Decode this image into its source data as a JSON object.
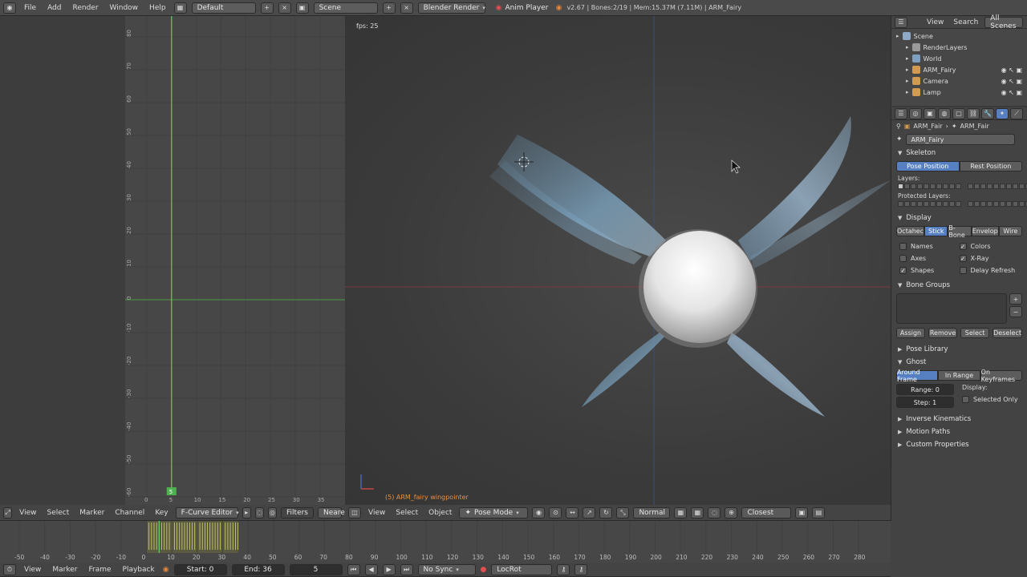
{
  "topbar": {
    "menus": [
      "File",
      "Add",
      "Render",
      "Window",
      "Help"
    ],
    "screen_layout": "Default",
    "scene": "Scene",
    "render_engine": "Blender Render",
    "anim_player": "Anim Player",
    "stats": "v2.67 | Bones:2/19 | Mem:15.37M (7.11M) | ARM_Fairy"
  },
  "graph_editor": {
    "y_ticks": [
      "80",
      "70",
      "60",
      "50",
      "40",
      "30",
      "20",
      "10",
      "0",
      "-10",
      "-20",
      "-30",
      "-40",
      "-50",
      "-60"
    ],
    "x_ticks": [
      "0",
      "5",
      "10",
      "15",
      "20",
      "25",
      "30",
      "35"
    ],
    "current_frame": "5",
    "header": {
      "menus": [
        "View",
        "Select",
        "Marker",
        "Channel",
        "Key"
      ],
      "mode": "F-Curve Editor",
      "filters": "Filters",
      "near": "Neare"
    }
  },
  "viewport": {
    "fps": "fps: 25",
    "object_label": "(5) ARM_fairy wingpointer",
    "header": {
      "menus": [
        "View",
        "Select",
        "Object"
      ],
      "mode": "Pose Mode",
      "orientation": "Normal",
      "snap": "Closest"
    }
  },
  "outliner": {
    "header": [
      "View",
      "Search",
      "All Scenes"
    ],
    "items": [
      {
        "label": "Scene",
        "indent": 0,
        "color": "#8fa9c9"
      },
      {
        "label": "RenderLayers",
        "indent": 1,
        "color": "#9a9a9a"
      },
      {
        "label": "World",
        "indent": 1,
        "color": "#7f9fc0"
      },
      {
        "label": "ARM_Fairy",
        "indent": 1,
        "color": "#d39a51"
      },
      {
        "label": "Camera",
        "indent": 1,
        "color": "#d39a51"
      },
      {
        "label": "Lamp",
        "indent": 1,
        "color": "#d39a51"
      }
    ]
  },
  "properties": {
    "breadcrumb": [
      "ARM_Fair",
      "ARM_Fair"
    ],
    "armature_name": "ARM_Fairy",
    "skeleton": {
      "title": "Skeleton",
      "pose_position": "Pose Position",
      "rest_position": "Rest Position",
      "layers": "Layers:",
      "protected_layers": "Protected Layers:"
    },
    "display": {
      "title": "Display",
      "modes": [
        "Octahec",
        "Stick",
        "B-Bone",
        "Envelop",
        "Wire"
      ],
      "active_mode": "Stick",
      "left_checks": [
        {
          "label": "Names",
          "checked": false
        },
        {
          "label": "Axes",
          "checked": false
        },
        {
          "label": "Shapes",
          "checked": true
        }
      ],
      "right_checks": [
        {
          "label": "Colors",
          "checked": true
        },
        {
          "label": "X-Ray",
          "checked": true
        },
        {
          "label": "Delay Refresh",
          "checked": false
        }
      ]
    },
    "bone_groups": {
      "title": "Bone Groups",
      "buttons": [
        "Assign",
        "Remove",
        "Select",
        "Deselect"
      ]
    },
    "pose_library": "Pose Library",
    "ghost": {
      "title": "Ghost",
      "modes": [
        "Around Frame",
        "In Range",
        "On Keyframes"
      ],
      "range": "Range: 0",
      "step": "Step: 1",
      "display_label": "Display:",
      "selected_only": "Selected Only"
    },
    "collapsed_panels": [
      "Inverse Kinematics",
      "Motion Paths",
      "Custom Properties"
    ]
  },
  "timeline": {
    "ticks": [
      "-50",
      "-40",
      "-30",
      "-20",
      "-10",
      "0",
      "10",
      "20",
      "30",
      "40",
      "50",
      "60",
      "70",
      "80",
      "90",
      "100",
      "110",
      "120",
      "130",
      "140",
      "150",
      "160",
      "170",
      "180",
      "190",
      "200",
      "210",
      "220",
      "230",
      "240",
      "250",
      "260",
      "270",
      "280"
    ],
    "header": {
      "menus": [
        "View",
        "Marker",
        "Frame",
        "Playback"
      ],
      "start": "Start: 0",
      "end": "End: 36",
      "frame": "5",
      "sync": "No Sync",
      "keying": "LocRot"
    }
  }
}
